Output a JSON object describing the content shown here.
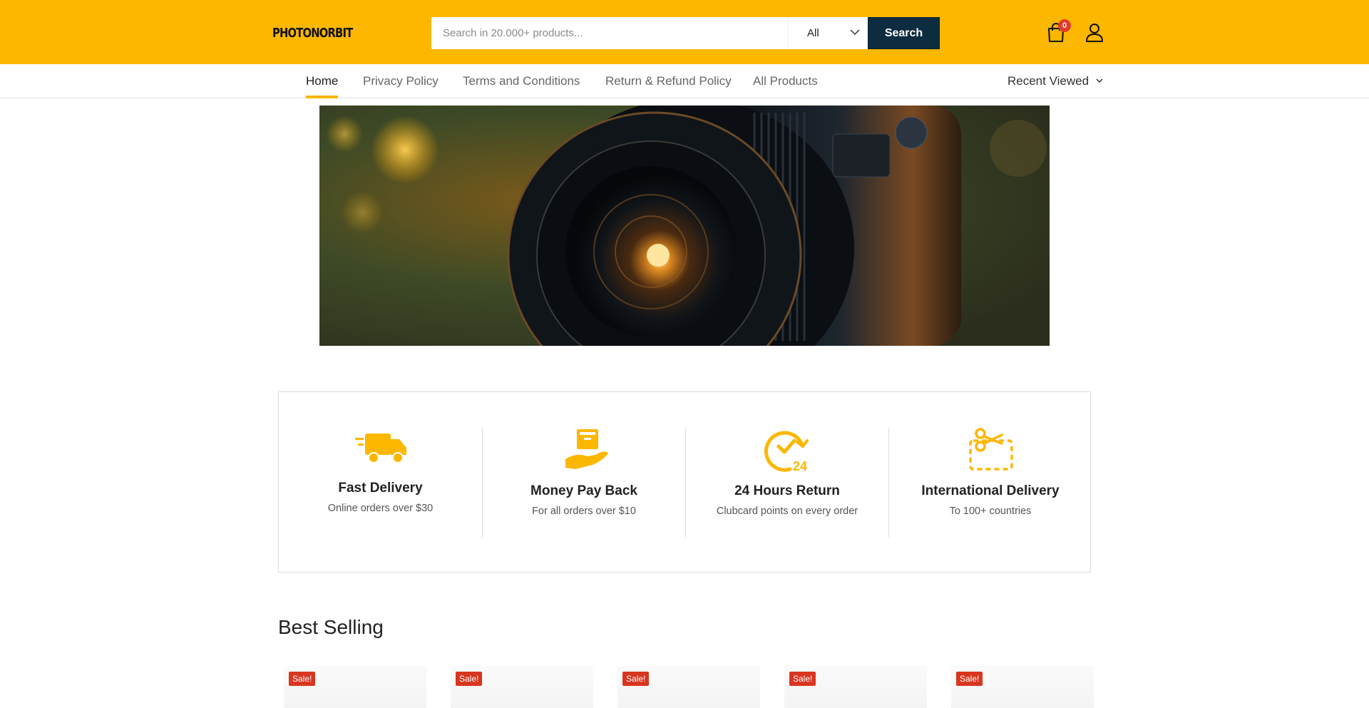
{
  "header": {
    "logo_text": "PHOTONORBIT",
    "search_placeholder": "Search in 20.000+ products...",
    "category_selected": "All",
    "search_button": "Search",
    "cart_count": "0",
    "colors": {
      "brand": "#fcb700",
      "search_button": "#0e2c3f",
      "badge": "#e23b2b"
    },
    "icons": [
      "shopping-bag-icon",
      "user-icon",
      "chevron-down-icon"
    ]
  },
  "nav": {
    "items": [
      {
        "label": "Home",
        "active": true
      },
      {
        "label": "Privacy Policy"
      },
      {
        "label": "Terms and Conditions"
      },
      {
        "label": "Return & Refund Policy"
      },
      {
        "label": "All Products"
      }
    ],
    "recent_viewed": "Recent Viewed"
  },
  "features": [
    {
      "icon": "truck-icon",
      "title": "Fast Delivery",
      "desc": "Online orders over $30"
    },
    {
      "icon": "money-back-icon",
      "title": "Money Pay Back",
      "desc": "For all orders over $10"
    },
    {
      "icon": "clock-24-icon",
      "title": "24 Hours Return",
      "desc": "Clubcard points on every order"
    },
    {
      "icon": "coupon-scissors-icon",
      "title": "International Delivery",
      "desc": "To 100+ countries"
    }
  ],
  "best_selling": {
    "title": "Best Selling",
    "badges": [
      "Sale!",
      "Sale!",
      "Sale!",
      "Sale!",
      "Sale!"
    ]
  }
}
